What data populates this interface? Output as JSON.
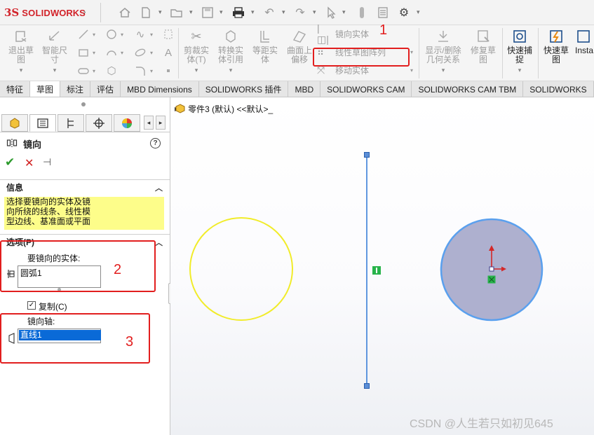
{
  "app": {
    "logo_mark": "3S",
    "logo_text_solid": "SOLID",
    "logo_text_works": "WORKS"
  },
  "ribbon": {
    "exit_sketch": "退出草\n图",
    "smart_dimension": "智能尺\n寸",
    "trim_entities": "剪裁实\n体(T)",
    "convert_entities": "转换实\n体引用",
    "offset_entities": "等距实\n体",
    "offset_surface": "曲面上\n偏移",
    "mirror_entities": "镜向实体",
    "linear_pattern": "线性草图阵列",
    "move_entities": "移动实体",
    "show_delete_relations": "显示/删除\n几何关系",
    "repair_sketch": "修复草\n图",
    "quick_snaps": "快速捕\n捉",
    "rapid_sketch": "快速草\n图",
    "instant2d": "Insta"
  },
  "annotations": {
    "n1": "1",
    "n2": "2",
    "n3": "3"
  },
  "tabs": [
    "特征",
    "草图",
    "标注",
    "评估",
    "MBD Dimensions",
    "SOLIDWORKS 插件",
    "MBD",
    "SOLIDWORKS CAM",
    "SOLIDWORKS CAM TBM",
    "SOLIDWORKS"
  ],
  "active_tab": "草图",
  "panel": {
    "title": "镜向",
    "help": "?",
    "ok": "✔",
    "cancel": "✕",
    "pin": "⊣",
    "info_heading": "信息",
    "info_text_1": "选择要镜向的实体及镜",
    "info_text_2": "向所绕的线条、线性模",
    "info_text_3": "型边线、基准面或平面",
    "options_heading": "选项(P)",
    "entities_label": "要镜向的实体:",
    "entities_value": "圆弧1",
    "copy_label": "复制(C)",
    "copy_checked": true,
    "axis_label": "镜向轴:",
    "axis_value": "直线1"
  },
  "canvas": {
    "tree_label": "零件3 (默认) <<默认>_",
    "watermark": "CSDN @人生若只如初见645"
  },
  "colors": {
    "accent_red": "#e21e1e",
    "circle_outline": "#f1ec2a",
    "mirror_line": "#3a7fd8",
    "selected_fill": "#aeb0cf",
    "info_bg": "#fdfd8a",
    "selection_blue": "#0a6ad7"
  },
  "icons": {
    "home": "home-icon",
    "new": "new-document-icon",
    "open": "open-folder-icon",
    "save": "save-icon",
    "print": "print-icon",
    "undo": "undo-icon",
    "redo": "redo-icon",
    "select": "select-pointer-icon",
    "rebuild": "rebuild-icon",
    "file_properties": "file-properties-icon",
    "options": "gear-icon"
  }
}
